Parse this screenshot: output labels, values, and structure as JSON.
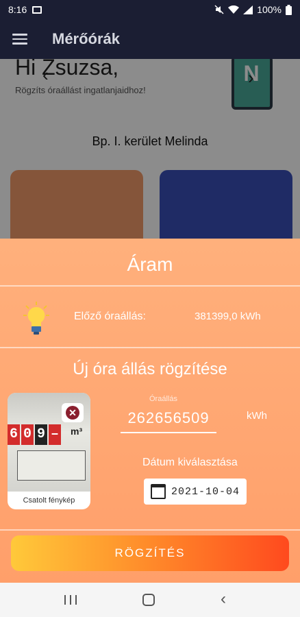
{
  "status": {
    "time": "8:16",
    "battery": "100%"
  },
  "appbar": {
    "title": "Mérőórák"
  },
  "home": {
    "greeting": "Hi Zsuzsa,",
    "subtitle": "Rögzíts óraállást ingatlanjaidhoz!",
    "building_name": "Bp. I. kerület Melinda"
  },
  "sheet": {
    "title": "Áram",
    "previous_label": "Előző óraállás:",
    "previous_value": "381399,0 kWh",
    "new_reading_title": "Új óra állás rögzítése",
    "photo_caption": "Csatolt fénykép",
    "photo_digits": [
      "6",
      "0",
      "9",
      "–"
    ],
    "photo_unit": "m³",
    "input_label": "Óraállás",
    "input_value": "262656509",
    "unit": "kWh",
    "date_label": "Dátum kiválasztása",
    "date_value": "2021-10-04",
    "save_label": "RÖGZÍTÉS"
  },
  "colors": {
    "sheet_top": "#ffb07c",
    "sheet_bottom": "#ff9f6a",
    "appbar": "#1b1e33",
    "card_orange": "#f39c6b",
    "card_blue": "#3a4fb8"
  },
  "icons": {
    "menu": "hamburger-icon",
    "bulb": "lightbulb-icon",
    "calendar": "calendar-icon",
    "close": "close-icon",
    "nfc": "nfc-phone-icon"
  }
}
